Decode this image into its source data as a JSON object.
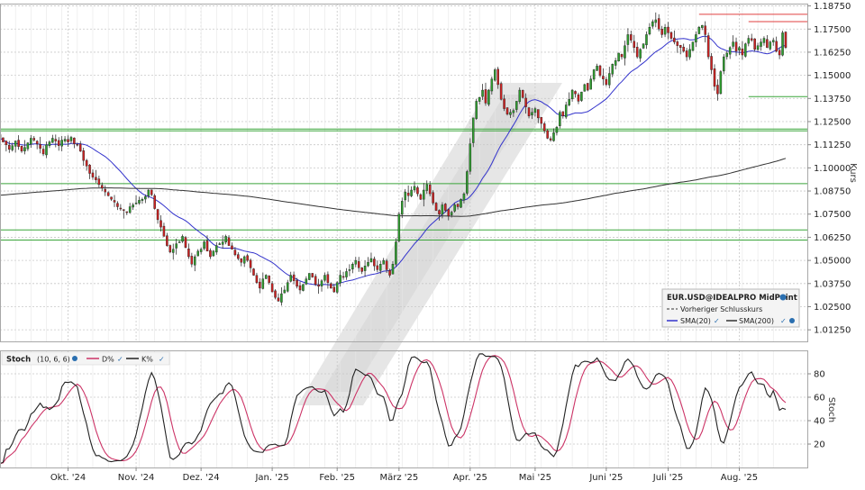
{
  "chart_data": [
    {
      "panel": "price",
      "type": "candlestick",
      "ylabel": "Kurs",
      "ylim": [
        1.00625,
        1.18875
      ],
      "yticks": [
        1.1875,
        1.175,
        1.1625,
        1.15,
        1.1375,
        1.125,
        1.1125,
        1.1,
        1.0875,
        1.075,
        1.0625,
        1.05,
        1.0375,
        1.025,
        1.0125
      ],
      "ytick_labels": [
        "1.18750",
        "1.17500",
        "1.16250",
        "1.15000",
        "1.13750",
        "1.12500",
        "1.11250",
        "1.10000",
        "1.08750",
        "1.07500",
        "1.06250",
        "1.05000",
        "1.03750",
        "1.02500",
        "1.01250"
      ],
      "months": [
        "Okt. '24",
        "Nov. '24",
        "Dez. '24",
        "Jan. '25",
        "Feb. '25",
        "März '25",
        "Apr. '25",
        "Mai '25",
        "Juni '25",
        "Juli '25",
        "Aug. '25"
      ],
      "month_pos": [
        22,
        44,
        65,
        88,
        109,
        129,
        152,
        173,
        196,
        216,
        239
      ],
      "x_range": [
        0,
        261
      ],
      "close": [
        1.116,
        1.114,
        1.1125,
        1.11,
        1.112,
        1.1145,
        1.1115,
        1.109,
        1.111,
        1.1135,
        1.116,
        1.115,
        1.113,
        1.1105,
        1.1075,
        1.1125,
        1.114,
        1.116,
        1.1145,
        1.112,
        1.115,
        1.1155,
        1.114,
        1.1165,
        1.113,
        1.1125,
        1.109,
        1.104,
        1.101,
        1.097,
        1.095,
        1.0935,
        1.091,
        1.089,
        1.087,
        1.085,
        1.083,
        1.0815,
        1.079,
        1.078,
        1.077,
        1.076,
        1.079,
        1.08,
        1.081,
        1.0825,
        1.083,
        1.0845,
        1.088,
        1.0855,
        1.078,
        1.072,
        1.068,
        1.063,
        1.058,
        1.0545,
        1.056,
        1.059,
        1.06,
        1.063,
        1.057,
        1.052,
        1.048,
        1.052,
        1.055,
        1.056,
        1.06,
        1.055,
        1.052,
        1.055,
        1.058,
        1.059,
        1.06,
        1.063,
        1.058,
        1.056,
        1.053,
        1.051,
        1.049,
        1.052,
        1.05,
        1.046,
        1.042,
        1.038,
        1.035,
        1.04,
        1.042,
        1.038,
        1.033,
        1.03,
        1.028,
        1.032,
        1.034,
        1.038,
        1.042,
        1.039,
        1.036,
        1.034,
        1.037,
        1.04,
        1.043,
        1.041,
        1.037,
        1.036,
        1.039,
        1.042,
        1.038,
        1.035,
        1.033,
        1.038,
        1.042,
        1.041,
        1.044,
        1.045,
        1.048,
        1.05,
        1.046,
        1.044,
        1.047,
        1.049,
        1.051,
        1.047,
        1.045,
        1.048,
        1.05,
        1.045,
        1.042,
        1.048,
        1.06,
        1.075,
        1.082,
        1.087,
        1.085,
        1.088,
        1.09,
        1.086,
        1.083,
        1.088,
        1.091,
        1.086,
        1.081,
        1.077,
        1.075,
        1.08,
        1.077,
        1.074,
        1.076,
        1.08,
        1.079,
        1.083,
        1.086,
        1.098,
        1.113,
        1.127,
        1.136,
        1.138,
        1.142,
        1.135,
        1.142,
        1.148,
        1.153,
        1.145,
        1.137,
        1.132,
        1.129,
        1.13,
        1.131,
        1.136,
        1.142,
        1.138,
        1.133,
        1.128,
        1.13,
        1.132,
        1.127,
        1.124,
        1.12,
        1.116,
        1.115,
        1.119,
        1.122,
        1.13,
        1.128,
        1.134,
        1.137,
        1.142,
        1.14,
        1.136,
        1.141,
        1.145,
        1.142,
        1.148,
        1.153,
        1.155,
        1.15,
        1.148,
        1.145,
        1.151,
        1.156,
        1.158,
        1.162,
        1.16,
        1.166,
        1.172,
        1.169,
        1.165,
        1.16,
        1.164,
        1.167,
        1.172,
        1.176,
        1.179,
        1.18,
        1.175,
        1.172,
        1.176,
        1.173,
        1.17,
        1.168,
        1.166,
        1.165,
        1.163,
        1.16,
        1.164,
        1.168,
        1.172,
        1.176,
        1.177,
        1.172,
        1.16,
        1.153,
        1.144,
        1.14,
        1.152,
        1.16,
        1.162,
        1.165,
        1.168,
        1.163,
        1.165,
        1.161,
        1.167,
        1.17,
        1.169,
        1.164,
        1.166,
        1.168,
        1.17,
        1.165,
        1.168,
        1.169,
        1.163,
        1.161,
        1.173,
        1.165
      ],
      "reference_lines": [
        {
          "color": "#e04040",
          "value": 1.183,
          "from_index": 226
        },
        {
          "color": "#e04040",
          "value": 1.179,
          "from_index": 242
        },
        {
          "color": "#3aa53a",
          "value": 1.1385,
          "from_index": 242
        },
        {
          "color": "#3aa53a",
          "value": 1.121,
          "from_index": 0
        },
        {
          "color": "#3aa53a",
          "value": 1.12,
          "from_index": 0
        },
        {
          "color": "#3aa53a",
          "value": 1.0915,
          "from_index": 0
        },
        {
          "color": "#3aa53a",
          "value": 1.0665,
          "from_index": 0
        },
        {
          "color": "#3aa53a",
          "value": 1.061,
          "from_index": 0
        }
      ],
      "legend": {
        "title": "EUR.USD@IDEALPRO MidPoint",
        "prev_close": "Vorheriger Schlusskurs",
        "sma20": "SMA(20)",
        "sma200": "SMA(200)"
      },
      "colors": {
        "up": "#2e9d2e",
        "down": "#cc2222",
        "sma20": "#3333cc",
        "sma200": "#333333",
        "grid": "#c8c8c8"
      }
    },
    {
      "panel": "stochastic",
      "type": "line",
      "ylabel": "Stoch",
      "ylim": [
        0,
        100
      ],
      "yticks": [
        20,
        40,
        60,
        80
      ],
      "ytick_labels": [
        "20",
        "40",
        "60",
        "80"
      ],
      "legend": {
        "title": "Stoch",
        "params": "(10, 6, 6)",
        "d_label": "D%",
        "k_label": "K%"
      },
      "colors": {
        "d": "#cc3366",
        "k": "#222222"
      }
    }
  ]
}
